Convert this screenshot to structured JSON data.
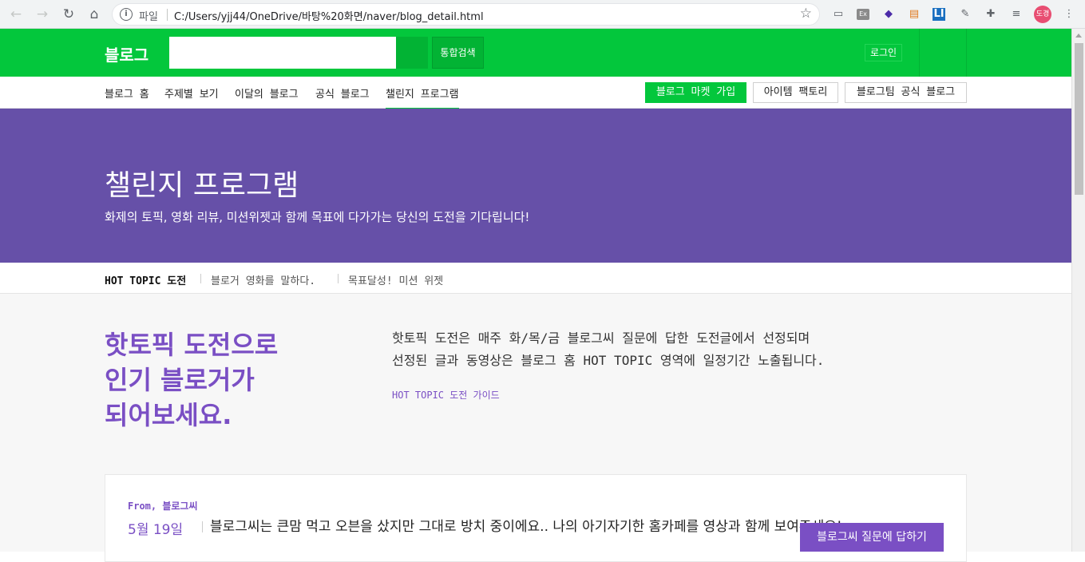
{
  "browser": {
    "url_scheme_label": "파일",
    "url": "C:/Users/yjj44/OneDrive/바탕%20화면/naver/blog_detail.html",
    "profile_initials": "도경"
  },
  "header": {
    "logo": "블로그",
    "search_placeholder": "",
    "search_button": "통합검색",
    "login_button": "로그인"
  },
  "subnav": {
    "items": [
      {
        "label": "블로그 홈"
      },
      {
        "label": "주제별 보기"
      },
      {
        "label": "이달의 블로그"
      },
      {
        "label": "공식 블로그"
      },
      {
        "label": "챌린지 프로그램"
      }
    ],
    "market_button": "블로그 마켓 가입",
    "item_factory_button": "아이템 팩토리",
    "official_blog_button": "블로그팀 공식 블로그"
  },
  "hero": {
    "title": "챌린지 프로그램",
    "subtitle": "화제의 토픽, 영화 리뷰, 미션위젯과 함께 목표에 다가가는 당신의 도전을 기다립니다!"
  },
  "tabs": [
    {
      "label": "HOT TOPIC 도전"
    },
    {
      "label": "블로거 영화를 말하다."
    },
    {
      "label": "목표달성! 미션 위젯"
    }
  ],
  "intro": {
    "title_lines": [
      "핫토픽 도전으로",
      "인기 블로거가",
      "되어보세요."
    ],
    "desc_line1": "핫토픽 도전은 매주 화/목/금 블로그씨 질문에 답한 도전글에서 선정되며",
    "desc_line2": "선정된 글과 동영상은 블로그 홈 HOT TOPIC 영역에 일정기간 노출됩니다.",
    "guide_link": "HOT TOPIC 도전 가이드"
  },
  "card": {
    "from": "From, 블로그씨",
    "date": "5월 19일",
    "question": "블로그씨는 큰맘 먹고 오븐을 샀지만 그대로 방치 중이에요.. 나의 아기자기한 홈카페를 영상과 함께 보여주세요!",
    "answer_button": "블로그씨 질문에 답하기"
  },
  "colors": {
    "naver_green": "#03c73c",
    "hero_purple": "#6650a8",
    "accent_purple": "#7a4fc4"
  },
  "icons": [
    "back-arrow-icon",
    "forward-arrow-icon",
    "reload-icon",
    "home-icon",
    "info-icon",
    "star-icon",
    "extension-icons",
    "menu-dots-icon"
  ]
}
